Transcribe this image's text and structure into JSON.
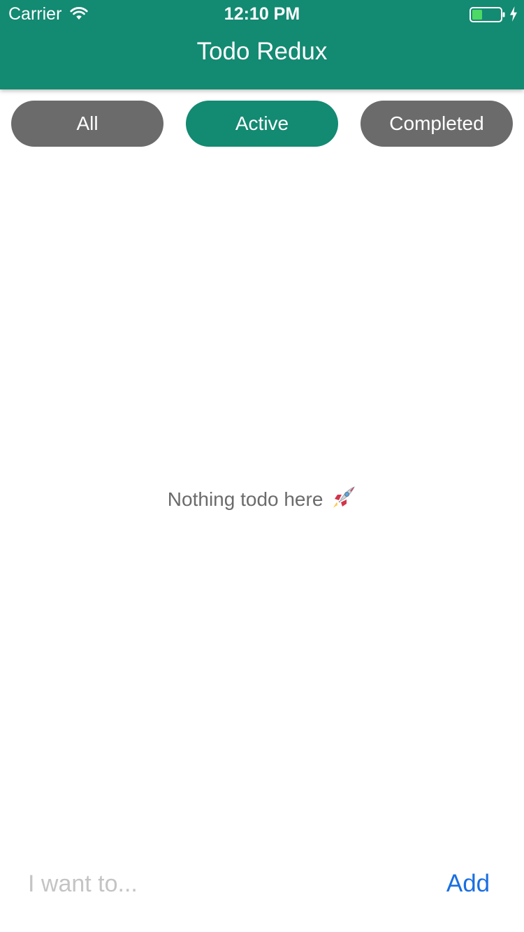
{
  "status_bar": {
    "carrier": "Carrier",
    "time": "12:10 PM",
    "wifi_icon": "wifi-icon",
    "battery_icon": "battery-icon",
    "charging_icon": "charging-bolt-icon"
  },
  "header": {
    "title": "Todo Redux",
    "background_color": "#138a72"
  },
  "filters": {
    "items": [
      {
        "label": "All",
        "selected": false
      },
      {
        "label": "Active",
        "selected": true
      },
      {
        "label": "Completed",
        "selected": false
      }
    ],
    "selected_color": "#138a72",
    "unselected_color": "#6b6b6b"
  },
  "empty_state": {
    "message": "Nothing todo here",
    "icon": "rocket-icon"
  },
  "input_bar": {
    "placeholder": "I want to...",
    "value": "",
    "add_label": "Add",
    "add_color": "#1a6fe0"
  }
}
